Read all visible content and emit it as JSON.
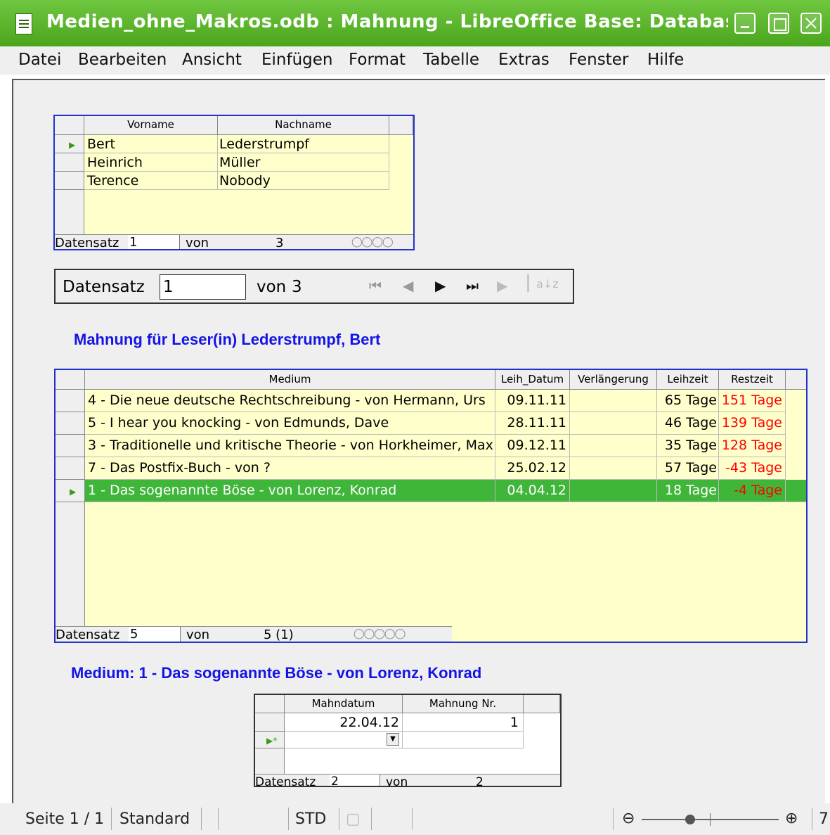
{
  "window": {
    "title": "Medien_ohne_Makros.odb : Mahnung - LibreOffice Base: Database F"
  },
  "menu": [
    "Datei",
    "Bearbeiten",
    "Ansicht",
    "Einfügen",
    "Format",
    "Tabelle",
    "Extras",
    "Fenster",
    "Hilfe"
  ],
  "reader_grid": {
    "headers": [
      "Vorname",
      "Nachname"
    ],
    "rows": [
      {
        "vorname": "Bert",
        "nachname": "Lederstrumpf"
      },
      {
        "vorname": "Heinrich",
        "nachname": "Müller"
      },
      {
        "vorname": "Terence",
        "nachname": "Nobody"
      }
    ],
    "nav": {
      "label": "Datensatz",
      "current": "1",
      "of_label": "von",
      "total": "3"
    }
  },
  "navbar": {
    "label": "Datensatz",
    "current": "1",
    "of_label": "von",
    "total": "3"
  },
  "heading_reminder": "Mahnung für Leser(in) Lederstrumpf, Bert",
  "media_grid": {
    "headers": [
      "Medium",
      "Leih_Datum",
      "Verlängerung",
      "Leihzeit",
      "Restzeit"
    ],
    "rows": [
      {
        "medium": "4 - Die neue deutsche Rechtschreibung - von Hermann, Urs",
        "datum": "09.11.11",
        "verl": "",
        "leihzeit": "65 Tage",
        "restzeit": "151 Tage"
      },
      {
        "medium": "5 - I hear you knocking - von Edmunds, Dave",
        "datum": "28.11.11",
        "verl": "",
        "leihzeit": "46 Tage",
        "restzeit": "139 Tage"
      },
      {
        "medium": "3 - Traditionelle und kritische Theorie - von Horkheimer, Max",
        "datum": "09.12.11",
        "verl": "",
        "leihzeit": "35 Tage",
        "restzeit": "128 Tage"
      },
      {
        "medium": "7 - Das Postfix-Buch - von ?",
        "datum": "25.02.12",
        "verl": "",
        "leihzeit": "57 Tage",
        "restzeit": "-43 Tage"
      },
      {
        "medium": "1 - Das sogenannte Böse - von Lorenz, Konrad",
        "datum": "04.04.12",
        "verl": "",
        "leihzeit": "18 Tage",
        "restzeit": "-4 Tage"
      }
    ],
    "nav": {
      "label": "Datensatz",
      "current": "5",
      "of_label": "von",
      "total": "5 (1)"
    }
  },
  "heading_medium": "Medium: 1 - Das sogenannte Böse - von Lorenz, Konrad",
  "reminder_grid": {
    "headers": [
      "Mahndatum",
      "Mahnung Nr."
    ],
    "rows": [
      {
        "datum": "22.04.12",
        "nr": "1"
      }
    ],
    "nav": {
      "label": "Datensatz",
      "current": "2",
      "of_label": "von",
      "total": "2"
    }
  },
  "status": {
    "page": "Seite 1 / 1",
    "style": "Standard",
    "mode": "STD",
    "zoom": "7"
  },
  "colors": {
    "titlebar": "#4aa51d",
    "heading": "#1414e6",
    "selection": "#3fb63a",
    "grid_bg": "#ffffcc",
    "negative": "#ff0000"
  }
}
